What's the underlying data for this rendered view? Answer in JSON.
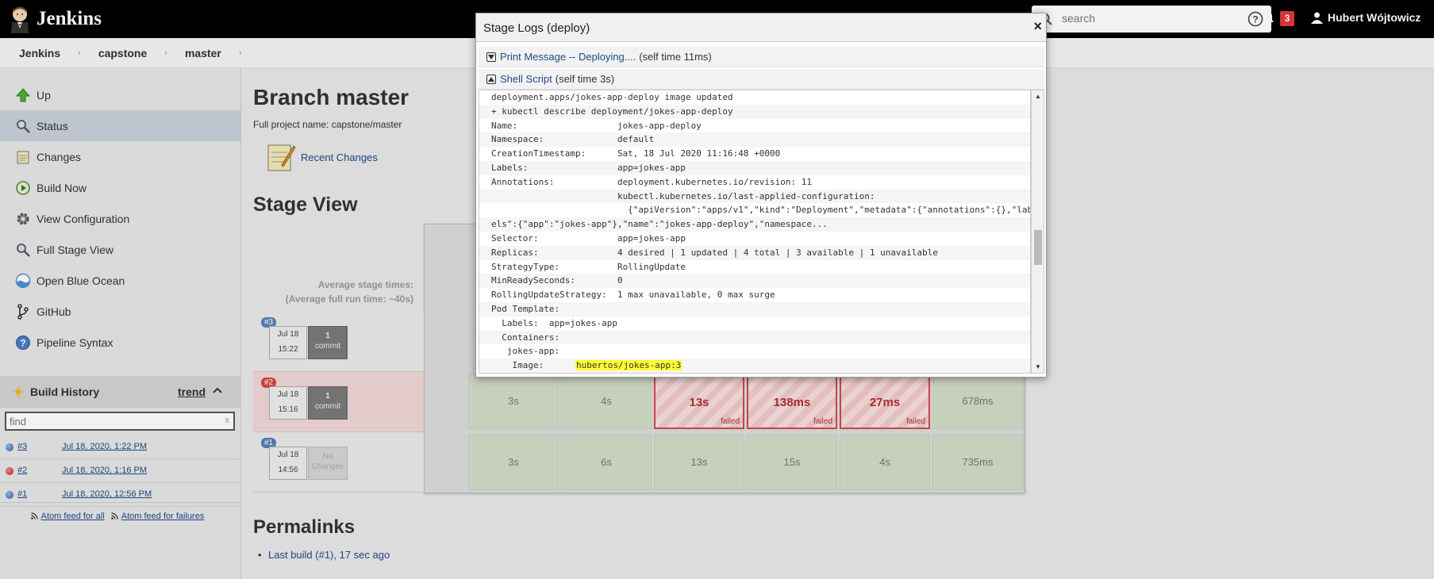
{
  "header": {
    "logo_text": "Jenkins",
    "search_placeholder": "search",
    "notification_count": "3",
    "user_name": "Hubert Wójtowicz"
  },
  "breadcrumb": [
    "Jenkins",
    "capstone",
    "master"
  ],
  "sidebar": {
    "tasks": [
      {
        "label": "Up",
        "icon": "up-arrow-icon"
      },
      {
        "label": "Status",
        "icon": "search-icon"
      },
      {
        "label": "Changes",
        "icon": "notepad-icon"
      },
      {
        "label": "Build Now",
        "icon": "clock-play-icon"
      },
      {
        "label": "View Configuration",
        "icon": "gear-icon"
      },
      {
        "label": "Full Stage View",
        "icon": "search-icon"
      },
      {
        "label": "Open Blue Ocean",
        "icon": "blue-ocean-icon"
      },
      {
        "label": "GitHub",
        "icon": "branch-icon"
      },
      {
        "label": "Pipeline Syntax",
        "icon": "help-icon"
      }
    ]
  },
  "build_history": {
    "title": "Build History",
    "trend": "trend",
    "find_placeholder": "find",
    "clear": "x",
    "builds": [
      {
        "num": "#3",
        "date": "Jul 18, 2020, 1:22 PM",
        "status": "blue"
      },
      {
        "num": "#2",
        "date": "Jul 18, 2020, 1:16 PM",
        "status": "red"
      },
      {
        "num": "#1",
        "date": "Jul 18, 2020, 12:56 PM",
        "status": "blue"
      }
    ],
    "atom_all": "Atom feed for all",
    "atom_failures": "Atom feed for failures"
  },
  "main": {
    "title": "Branch master",
    "full_name": "Full project name: capstone/master",
    "recent_changes": "Recent Changes",
    "stage_view_title": "Stage View",
    "avg_stage_times": "Average stage times:",
    "avg_full_run": "(Average full run time: ~40s)",
    "runs": [
      {
        "badge": "#3",
        "date": "Jul 18",
        "time": "15:22",
        "commit1": "1",
        "commit2": "commit",
        "badge_color": "#5a7fb5"
      },
      {
        "badge": "#2",
        "date": "Jul 18",
        "time": "15:16",
        "commit1": "1",
        "commit2": "commit",
        "badge_color": "#d24545"
      },
      {
        "badge": "#1",
        "date": "Jul 18",
        "time": "14:56",
        "commit1": "No",
        "commit2": "Changes",
        "badge_color": "#5a7fb5"
      }
    ],
    "row2_cells": [
      "3s",
      "4s",
      "13s",
      "138ms",
      "27ms",
      "678ms"
    ],
    "row3_cells": [
      "3s",
      "6s",
      "13s",
      "15s",
      "4s",
      "735ms"
    ],
    "failed_label": "failed",
    "permalinks_title": "Permalinks",
    "permalink_last": "Last build (#1), 17 sec ago"
  },
  "modal": {
    "title": "Stage Logs (deploy)",
    "close": "×",
    "step1_link": "Print Message -- Deploying....",
    "step1_time": "(self time 11ms)",
    "step2_link": "Shell Script",
    "step2_time": "(self time 3s)",
    "log_lines": [
      "deployment.apps/jokes-app-deploy image updated",
      "+ kubectl describe deployment/jokes-app-deploy",
      "Name:                   jokes-app-deploy",
      "Namespace:              default",
      "CreationTimestamp:      Sat, 18 Jul 2020 11:16:48 +0000",
      "Labels:                 app=jokes-app",
      "Annotations:            deployment.kubernetes.io/revision: 11",
      "                        kubectl.kubernetes.io/last-applied-configuration:",
      "                          {\"apiVersion\":\"apps/v1\",\"kind\":\"Deployment\",\"metadata\":{\"annotations\":{},\"lab",
      "els\":{\"app\":\"jokes-app\"},\"name\":\"jokes-app-deploy\",\"namespace...",
      "Selector:               app=jokes-app",
      "Replicas:               4 desired | 1 updated | 4 total | 3 available | 1 unavailable",
      "StrategyType:           RollingUpdate",
      "MinReadySeconds:        0",
      "RollingUpdateStrategy:  1 max unavailable, 0 max surge",
      "Pod Template:",
      "  Labels:  app=jokes-app",
      "  Containers:",
      "   jokes-app:"
    ],
    "image_label": "    Image:      ",
    "image_value": "hubertos/jokes-app:3"
  }
}
